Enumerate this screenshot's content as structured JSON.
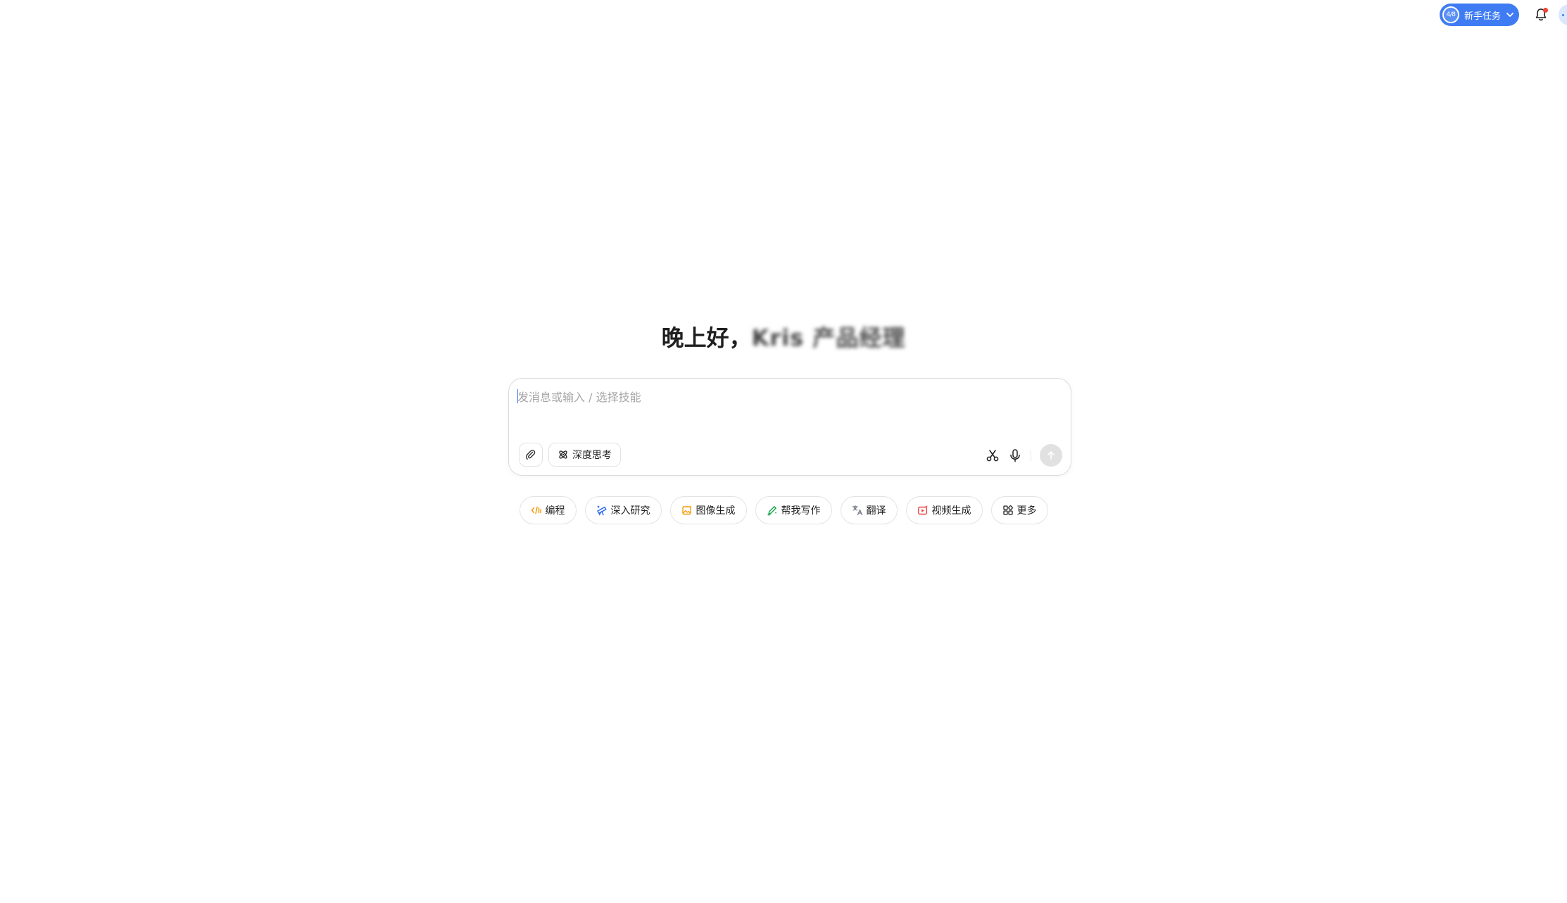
{
  "header": {
    "task_progress": "4/8",
    "task_label": "新手任务",
    "accent_color": "#3f7cf3",
    "notification_dot_color": "#f04438",
    "icons": [
      "chevron-down-icon",
      "bell-icon",
      "avatar"
    ]
  },
  "greeting": {
    "prefix": "晚上好，",
    "name": "Kris 产品经理"
  },
  "composer": {
    "placeholder": "发消息或输入 / 选择技能",
    "value": "",
    "deep_think_label": "深度思考",
    "icons": [
      "paperclip-icon",
      "atom-icon",
      "scissors-icon",
      "microphone-icon",
      "arrow-up-icon"
    ]
  },
  "skills": [
    {
      "label": "编程",
      "icon": "code-icon",
      "color": "#f59e0b"
    },
    {
      "label": "深入研究",
      "icon": "telescope-icon",
      "color": "#2563eb"
    },
    {
      "label": "图像生成",
      "icon": "image-icon",
      "color": "#f59e0b"
    },
    {
      "label": "帮我写作",
      "icon": "pen-icon",
      "color": "#16a34a"
    },
    {
      "label": "翻译",
      "icon": "translate-icon",
      "color": "#6b7280"
    },
    {
      "label": "视频生成",
      "icon": "video-icon",
      "color": "#ef4444"
    },
    {
      "label": "更多",
      "icon": "grid-icon",
      "color": "#1f1f1f"
    }
  ]
}
